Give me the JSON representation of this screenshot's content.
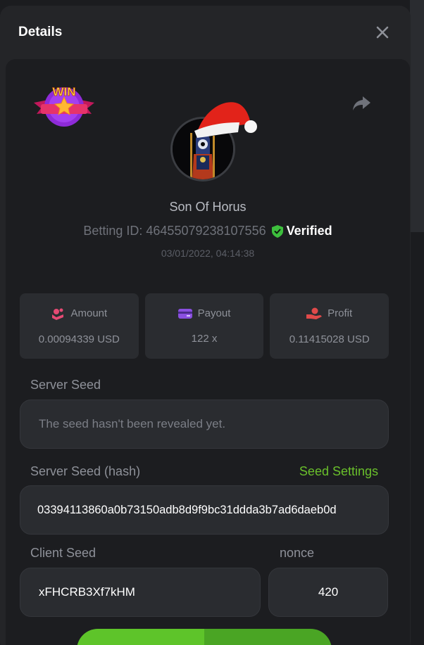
{
  "modal": {
    "title": "Details",
    "badge_text": "WIN"
  },
  "player": {
    "name": "Son Of Horus",
    "betting_id_label": "Betting ID: 46455079238107556",
    "verified_label": "Verified",
    "timestamp": "03/01/2022, 04:14:38"
  },
  "stats": [
    {
      "label": "Amount",
      "value": "0.00094339 USD",
      "icon": "amount-icon",
      "color": "#e64a74"
    },
    {
      "label": "Payout",
      "value": "122 x",
      "icon": "wallet-icon",
      "color": "#8a4fe0"
    },
    {
      "label": "Profit",
      "value": "0.11415028 USD",
      "icon": "profit-hand-icon",
      "color": "#e04a4a"
    }
  ],
  "server_seed": {
    "label": "Server Seed",
    "value": "The seed hasn't been revealed yet."
  },
  "server_seed_hash": {
    "label": "Server Seed (hash)",
    "value": "03394113860a0b73150adb8d9f9bc31ddda3b7ad6daeb0d",
    "settings_link": "Seed Settings"
  },
  "client_seed": {
    "label": "Client Seed",
    "value": "xFHCRB3Xf7kHM"
  },
  "nonce": {
    "label": "nonce",
    "value": "420"
  },
  "colors": {
    "accent_green": "#6ac02b",
    "verified_shield": "#3dbf3d",
    "panel": "#1c1d20",
    "card": "#2a2c30"
  }
}
